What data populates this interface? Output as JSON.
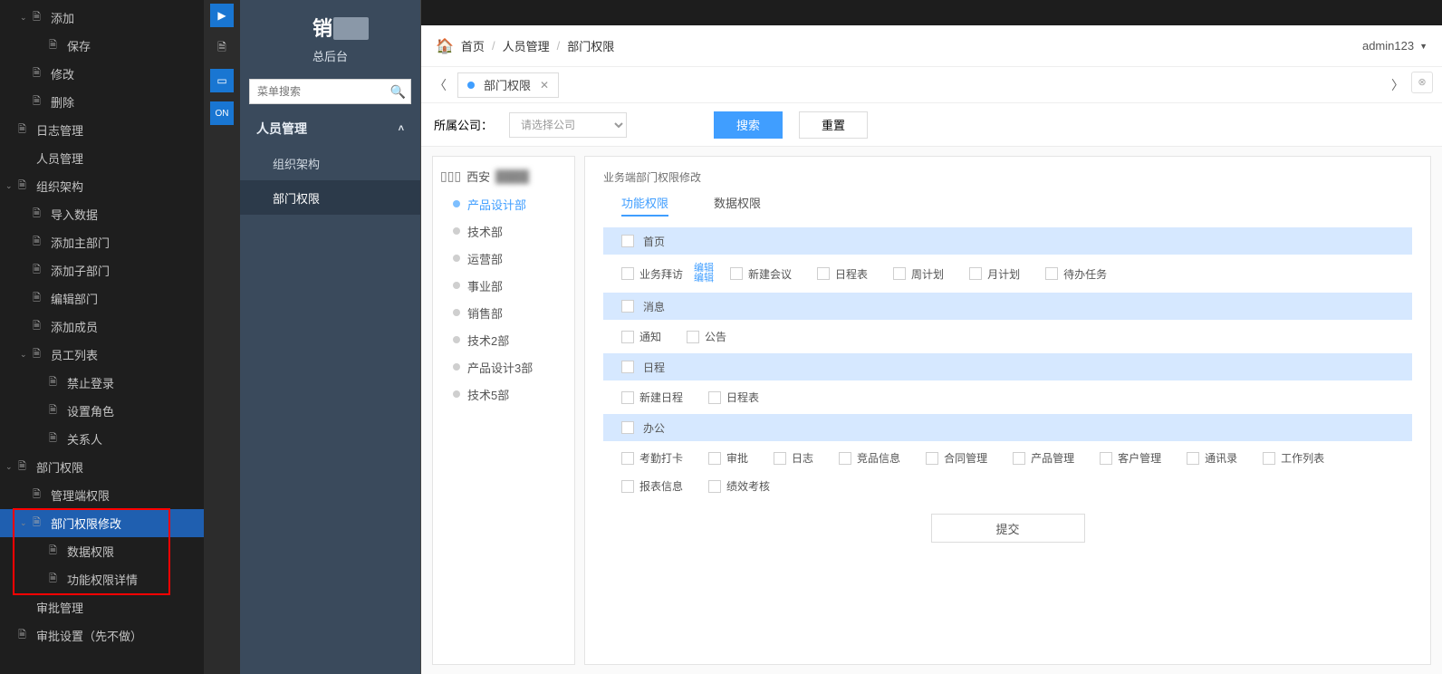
{
  "left_tree": {
    "items": [
      {
        "chev": "⌄",
        "icon": "🗎",
        "label": "添加",
        "level": 1
      },
      {
        "chev": "",
        "icon": "🗎",
        "label": "保存",
        "level": 2
      },
      {
        "chev": "",
        "icon": "🗎",
        "label": "修改",
        "level": 1
      },
      {
        "chev": "",
        "icon": "🗎",
        "label": "删除",
        "level": 1
      },
      {
        "chev": "",
        "icon": "🗎",
        "label": "日志管理",
        "level": 0
      },
      {
        "chev": "",
        "icon": "🗎",
        "label": "人员管理",
        "level": 0,
        "nofile": true
      },
      {
        "chev": "⌄",
        "icon": "🗎",
        "label": "组织架构",
        "level": 0
      },
      {
        "chev": "",
        "icon": "🗎",
        "label": "导入数据",
        "level": 1
      },
      {
        "chev": "",
        "icon": "🗎",
        "label": "添加主部门",
        "level": 1
      },
      {
        "chev": "",
        "icon": "🗎",
        "label": "添加子部门",
        "level": 1
      },
      {
        "chev": "",
        "icon": "🗎",
        "label": "编辑部门",
        "level": 1
      },
      {
        "chev": "",
        "icon": "🗎",
        "label": "添加成员",
        "level": 1
      },
      {
        "chev": "⌄",
        "icon": "🗎",
        "label": "员工列表",
        "level": 1
      },
      {
        "chev": "",
        "icon": "🗎",
        "label": "禁止登录",
        "level": 2
      },
      {
        "chev": "",
        "icon": "🗎",
        "label": "设置角色",
        "level": 2
      },
      {
        "chev": "",
        "icon": "🗎",
        "label": "关系人",
        "level": 2
      },
      {
        "chev": "⌄",
        "icon": "🗎",
        "label": "部门权限",
        "level": 0
      },
      {
        "chev": "",
        "icon": "🗎",
        "label": "管理端权限",
        "level": 1
      },
      {
        "chev": "⌄",
        "icon": "🗎",
        "label": "部门权限修改",
        "level": 1,
        "active": true
      },
      {
        "chev": "",
        "icon": "🗎",
        "label": "数据权限",
        "level": 2
      },
      {
        "chev": "",
        "icon": "🗎",
        "label": "功能权限详情",
        "level": 2
      },
      {
        "chev": "",
        "icon": "🗎",
        "label": "审批管理",
        "level": 0,
        "nofile": true
      },
      {
        "chev": "",
        "icon": "🗎",
        "label": "审批设置（先不做）",
        "level": 0
      }
    ]
  },
  "vtoolbar": {
    "items": [
      "▶",
      "🗎",
      "📱",
      "⇅"
    ]
  },
  "brand": {
    "title": "销",
    "masked": "　",
    "sub": "总后台"
  },
  "search": {
    "placeholder": "菜单搜索"
  },
  "menu2": {
    "group": "人员管理",
    "items": [
      {
        "label": "组织架构"
      },
      {
        "label": "部门权限",
        "active": true
      }
    ]
  },
  "breadcrumb": {
    "home": "首页",
    "a": "人员管理",
    "b": "部门权限"
  },
  "user": {
    "name": "admin123"
  },
  "tab": {
    "label": "部门权限"
  },
  "filter": {
    "company_label": "所属公司：",
    "company_placeholder": "请选择公司",
    "search": "搜索",
    "reset": "重置"
  },
  "org_tree": {
    "root": "西安",
    "nodes": [
      {
        "label": "产品设计部",
        "active": true
      },
      {
        "label": "技术部"
      },
      {
        "label": "运营部"
      },
      {
        "label": "事业部"
      },
      {
        "label": "销售部"
      },
      {
        "label": "技术2部"
      },
      {
        "label": "产品设计3部"
      },
      {
        "label": "技术5部"
      }
    ]
  },
  "perm": {
    "title": "业务端部门权限修改",
    "tabs": {
      "a": "功能权限",
      "b": "数据权限"
    },
    "edit": "编辑",
    "groups": [
      {
        "header": "首页",
        "rows": [
          [
            "业务拜访",
            "__EDIT__",
            "新建会议",
            "日程表",
            "周计划",
            "月计划",
            "待办任务"
          ]
        ]
      },
      {
        "header": "消息",
        "rows": [
          [
            "通知",
            "公告"
          ]
        ]
      },
      {
        "header": "日程",
        "rows": [
          [
            "新建日程",
            "日程表"
          ]
        ],
        "noheaderbg": false
      },
      {
        "header": "办公",
        "rows": [
          [
            "考勤打卡",
            "审批",
            "日志",
            "竞品信息",
            "合同管理",
            "产品管理",
            "客户管理",
            "通讯录",
            "工作列表"
          ],
          [
            "报表信息",
            "绩效考核"
          ]
        ]
      }
    ],
    "submit": "提交"
  }
}
